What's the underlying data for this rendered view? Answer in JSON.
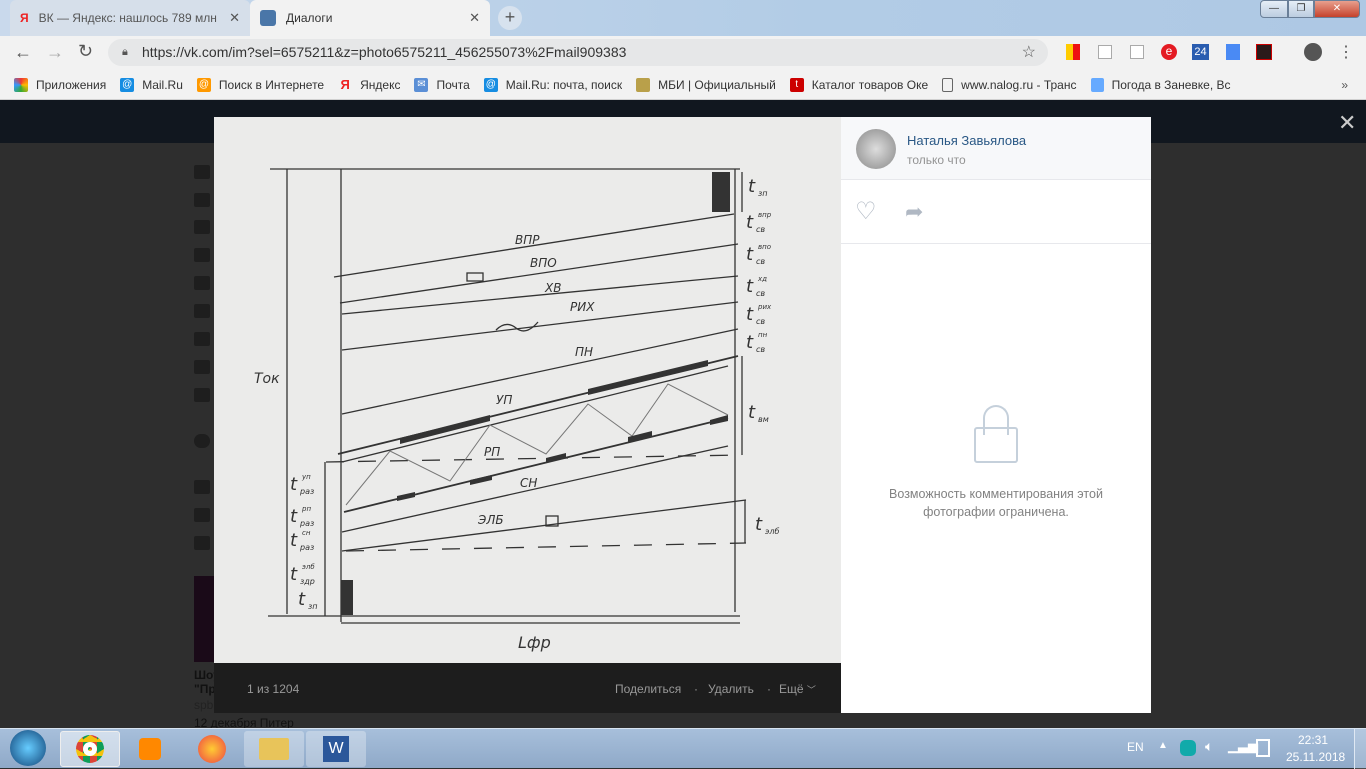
{
  "browser": {
    "tabs": [
      {
        "label": "ВК — Яндекс: нашлось 789 млн",
        "icon": "yandex-icon"
      },
      {
        "label": "Диалоги",
        "icon": "vk-dialogs-icon"
      }
    ],
    "url": "https://vk.com/im?sel=6575211&z=photo6575211_456255073%2Fmail909383",
    "bookmarks": [
      "Приложения",
      "Mail.Ru",
      "Поиск в Интернете",
      "Яндекс",
      "Почта",
      "Mail.Ru: почта, поиск",
      "МБИ | Официальный",
      "Каталог товаров Оке",
      "www.nalog.ru - Транс",
      "Погода в Заневке, Вс"
    ],
    "more": "»",
    "ext_24": "24"
  },
  "photo": {
    "layers": [
      "ВПР",
      "ВПО",
      "ХВ",
      "РИХ",
      "ПН",
      "УП",
      "РП",
      "СН",
      "ЭЛБ"
    ],
    "right": [
      {
        "t": "t",
        "sub": "зп",
        "sup": ""
      },
      {
        "t": "t",
        "sub": "св",
        "sup": "впр"
      },
      {
        "t": "t",
        "sub": "св",
        "sup": "впо"
      },
      {
        "t": "t",
        "sub": "св",
        "sup": "хд"
      },
      {
        "t": "t",
        "sub": "св",
        "sup": "рих"
      },
      {
        "t": "t",
        "sub": "св",
        "sup": "пн"
      },
      {
        "t": "t",
        "sub": "вм",
        "sup": ""
      },
      {
        "t": "t",
        "sub": "элб",
        "sup": ""
      }
    ],
    "left": [
      {
        "t": "t",
        "sub": "раз",
        "sup": "уп"
      },
      {
        "t": "t",
        "sub": "раз",
        "sup": "рп"
      },
      {
        "t": "t",
        "sub": "раз",
        "sup": "сн"
      },
      {
        "t": "t",
        "sub": "здр",
        "sup": "элб"
      },
      {
        "t": "t",
        "sub": "зп",
        "sup": ""
      }
    ],
    "tok": "Tок",
    "lfr": "Lфр",
    "counter": "1 из 1204",
    "share": "Поделиться",
    "delete": "Удалить",
    "more": "Ещё"
  },
  "post": {
    "author": "Наталья Завьялова",
    "time": "только что",
    "comments_closed": "Возможность комментирования этой фотографии ограничена."
  },
  "sidebar_ad": {
    "title1": "Шоу",
    "title2": "\"Пр",
    "src": "spb",
    "date": "12 декабря Питер"
  },
  "tray": {
    "lang": "EN",
    "time": "22:31",
    "date": "25.11.2018"
  }
}
